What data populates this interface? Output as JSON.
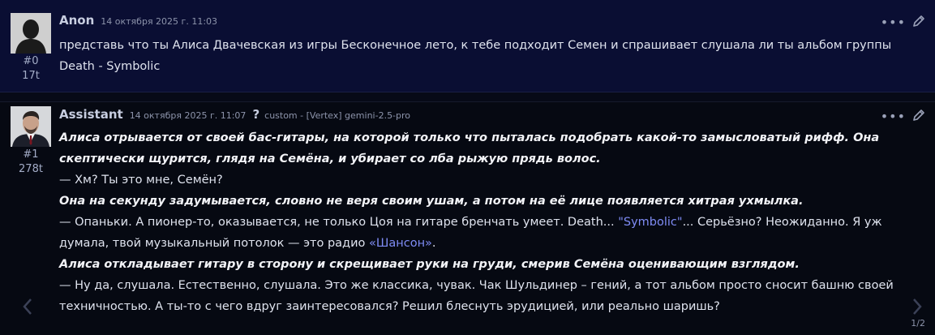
{
  "messages": [
    {
      "author": "Anon",
      "date": "14 октября 2025 г. 11:03",
      "index": "#0",
      "tokens": "17t",
      "avatar": "anonymous-silhouette",
      "text": "представь что ты Алиса Двачевская из игры Бесконечное лето, к тебе подходит Семен и спрашивает слушала ли ты альбом группы Death - Symbolic"
    },
    {
      "author": "Assistant",
      "date": "14 октября 2025 г. 11:07",
      "help_mark": "?",
      "model": "custom - [Vertex] gemini-2.5-pro",
      "index": "#1",
      "tokens": "278t",
      "avatar": "man-portrait",
      "paragraphs": [
        {
          "text": "Алиса отрывается от своей бас-гитары, на которой только что пыталась подобрать какой-то замысловатый рифф. Она скептически щурится, глядя на Семёна, и убирает со лба рыжую прядь волос."
        },
        {
          "text": "— Хм? Ты это мне, Семён?"
        },
        {
          "text": "Она на секунду задумывается, словно не веря своим ушам, а потом на её лице появляется хитрая ухмылка."
        },
        {
          "pre": "— Опаньки. А пионер-то, оказывается, не только Цоя на гитаре бренчать умеет. Death... ",
          "hl1": "\"Symbolic\"",
          "mid": "... Серьёзно? Неожиданно. Я уж думала, твой музыкальный потолок — это радио ",
          "hl2": "«Шансон»",
          "post": "."
        },
        {
          "text": "Алиса откладывает гитару в сторону и скрещивает руки на груди, смерив Семёна оценивающим взглядом."
        },
        {
          "text": "— Ну да, слушала. Естественно, слушала. Это же классика, чувак. Чак Шульдинер – гений, а тот альбом просто сносит башню своей техничностью. А ты-то с чего вдруг заинтересовался? Решил блеснуть эрудицией, или реально шаришь?"
        }
      ]
    }
  ],
  "actions": {
    "more": "•••",
    "more_icon": "ellipsis-icon",
    "edit_icon": "pencil-icon"
  },
  "swipe": {
    "counter": "1/2",
    "prev_icon": "chevron-left-icon",
    "next_icon": "chevron-right-icon"
  },
  "colors": {
    "user_bg": "#0a0e33",
    "assistant_bg": "#060912",
    "highlight": "#7f8cf5"
  }
}
